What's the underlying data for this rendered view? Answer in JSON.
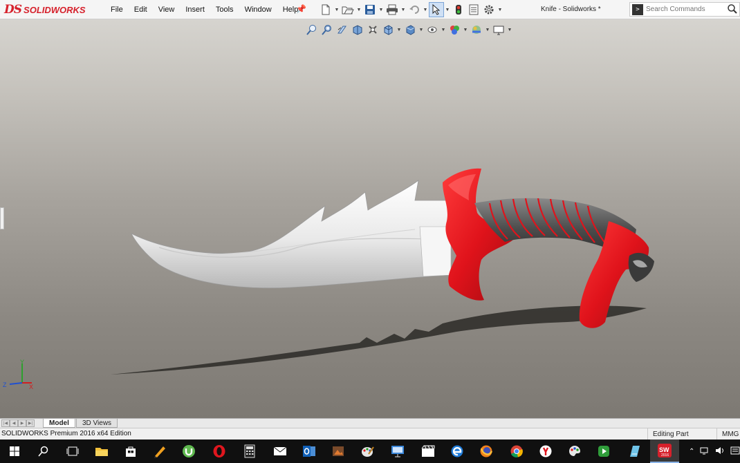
{
  "app": {
    "logo_mark": "DS",
    "logo_text": "SOLIDWORKS",
    "brand_color": "#d6202b",
    "window_title": "Knife - Solidworks *"
  },
  "menu": {
    "items": [
      "File",
      "Edit",
      "View",
      "Insert",
      "Tools",
      "Window",
      "Help"
    ]
  },
  "toolbar": {
    "icons": [
      "new-document-icon",
      "open-folder-icon",
      "save-icon",
      "print-icon",
      "undo-icon",
      "select-arrow-icon",
      "rebuild-traffic-light-icon",
      "file-properties-icon",
      "options-gear-icon"
    ]
  },
  "search": {
    "placeholder": "Search Commands",
    "prompt_glyph": ">"
  },
  "heads_up_toolbar": {
    "icons": [
      "zoom-to-fit-icon",
      "zoom-to-area-icon",
      "previous-view-icon",
      "section-view-icon",
      "dynamic-annotation-icon",
      "view-orientation-icon",
      "display-style-icon",
      "hide-show-items-icon",
      "edit-appearance-icon",
      "apply-scene-icon",
      "view-settings-icon"
    ]
  },
  "model": {
    "name": "Knife",
    "blade_color": "#e6e6e6",
    "guard_color": "#e0131b",
    "grip_color": "#5a5a5a",
    "shadow_color": "#2c2a27"
  },
  "triad": {
    "axes": [
      "Y",
      "Z",
      "X"
    ]
  },
  "tabs": {
    "nav_glyphs": [
      "|◀",
      "◀",
      "▶",
      "▶|"
    ],
    "items": [
      {
        "label": "Model",
        "active": true
      },
      {
        "label": "3D Views",
        "active": false
      }
    ]
  },
  "status": {
    "edition": "SOLIDWORKS Premium 2016 x64 Edition",
    "mode": "Editing Part",
    "units": "MMG"
  },
  "taskbar": {
    "apps": [
      "windows-start-icon",
      "search-icon",
      "task-view-icon",
      "file-explorer-icon",
      "store-icon",
      "sketch-app-icon",
      "utorrent-icon",
      "opera-icon",
      "calculator-icon",
      "mail-icon",
      "outlook-icon",
      "photo-app-icon",
      "paint-app-icon",
      "remote-desktop-icon",
      "video-editor-icon",
      "edge-icon",
      "firefox-icon",
      "chrome-icon",
      "yandex-icon",
      "paint-palette-icon",
      "camtasia-icon",
      "notepad-icon",
      "solidworks-icon"
    ],
    "solidworks_badge": "SW",
    "solidworks_year": "2016"
  }
}
